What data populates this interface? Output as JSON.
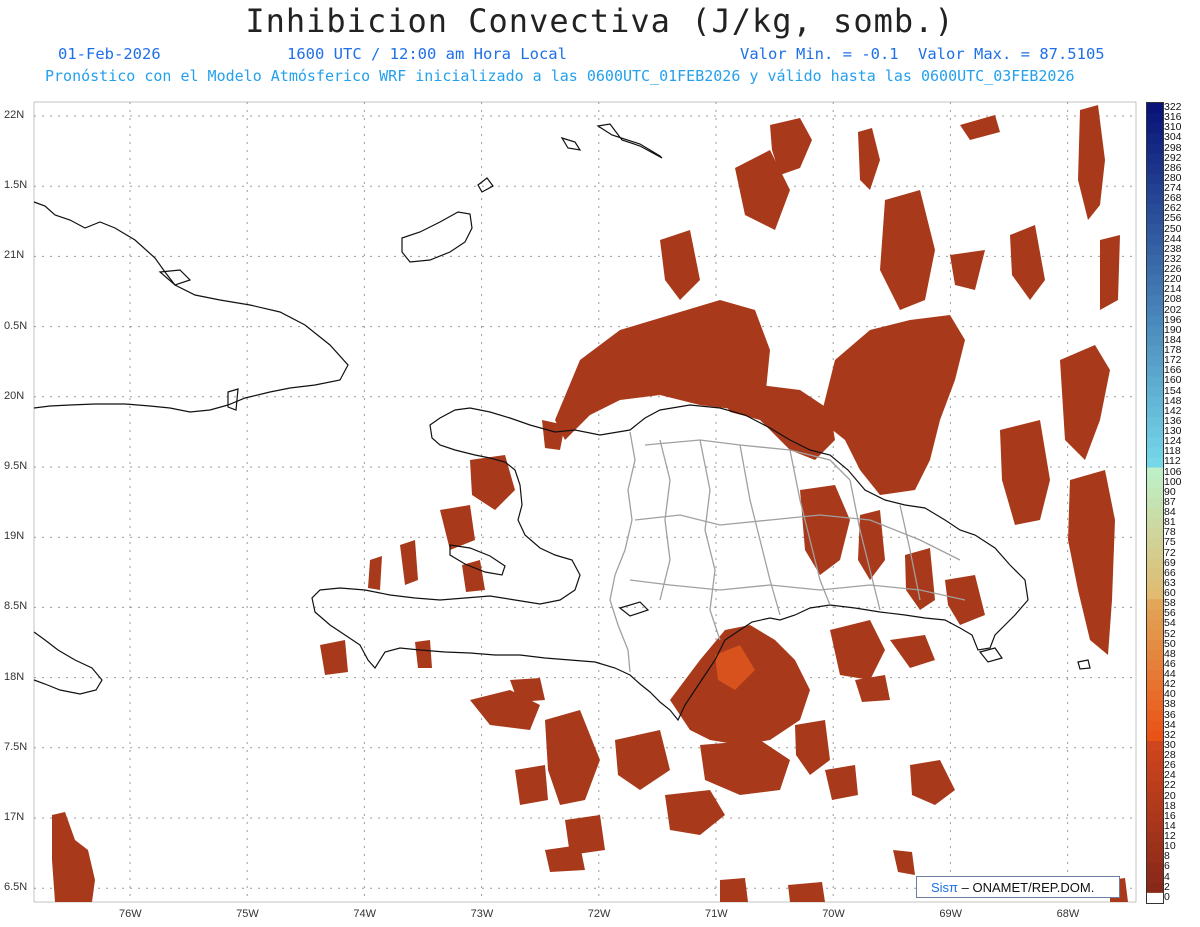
{
  "header": {
    "title": "Inhibicion Convectiva (J/kg, somb.)",
    "date": "01-Feb-2026",
    "time": "1600 UTC / 12:00 am Hora Local",
    "min_label": "Valor Min. = -0.1",
    "max_label": "Valor Max. = 87.5105",
    "forecast_line": "Pronóstico con el Modelo Atmósferico WRF inicializado a las 0600UTC_01FEB2026 y válido hasta las  0600UTC_03FEB2026"
  },
  "map": {
    "lat_labels": [
      "22N",
      "1.5N",
      "21N",
      "0.5N",
      "20N",
      "9.5N",
      "19N",
      "8.5N",
      "18N",
      "7.5N",
      "17N",
      "6.5N"
    ],
    "lon_labels": [
      "76W",
      "75W",
      "74W",
      "73W",
      "72W",
      "71W",
      "70W",
      "69W",
      "68W"
    ],
    "colors": {
      "shading": "#a8391a",
      "shading_dark": "#8b2c14",
      "shading_light": "#d7521d",
      "coast": "#111111",
      "borders": "#a0a0a0",
      "grid": "#9a9a9a"
    }
  },
  "colorbar": {
    "labels": [
      "322",
      "316",
      "310",
      "304",
      "298",
      "292",
      "286",
      "280",
      "274",
      "268",
      "262",
      "256",
      "250",
      "244",
      "238",
      "232",
      "226",
      "220",
      "214",
      "208",
      "202",
      "196",
      "190",
      "184",
      "178",
      "172",
      "166",
      "160",
      "154",
      "148",
      "142",
      "136",
      "130",
      "124",
      "118",
      "112",
      "106",
      "100",
      "90",
      "87",
      "84",
      "81",
      "78",
      "75",
      "72",
      "69",
      "66",
      "63",
      "60",
      "58",
      "56",
      "54",
      "52",
      "50",
      "48",
      "46",
      "44",
      "42",
      "40",
      "38",
      "36",
      "34",
      "32",
      "30",
      "28",
      "26",
      "24",
      "22",
      "20",
      "18",
      "16",
      "14",
      "12",
      "10",
      "8",
      "6",
      "4",
      "2",
      "0"
    ]
  },
  "credit": {
    "logo": "Sisπ",
    "org": "– ONAMET/REP.DOM."
  }
}
